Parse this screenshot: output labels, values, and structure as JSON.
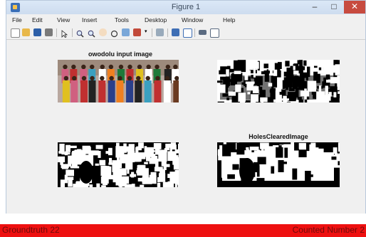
{
  "window": {
    "title": "Figure 1",
    "controls": {
      "minimize": "–",
      "maximize": "□",
      "close": "✕"
    }
  },
  "menubar": [
    "File",
    "Edit",
    "View",
    "Insert",
    "Tools",
    "Desktop",
    "Window",
    "Help"
  ],
  "toolbar": {
    "icons": [
      "new-figure-icon",
      "open-file-icon",
      "save-icon",
      "print-icon",
      "pointer-icon",
      "zoom-in-icon",
      "zoom-out-icon",
      "pan-icon",
      "rotate-3d-icon",
      "data-cursor-icon",
      "brush-icon",
      "link-plot-icon",
      "colorbar-icon",
      "legend-icon",
      "hide-plot-tools-icon",
      "show-plot-tools-icon"
    ]
  },
  "figure": {
    "panels": [
      {
        "title": "owodolu input image"
      },
      {
        "title": ""
      },
      {
        "title": ""
      },
      {
        "title": "HolesClearedImage"
      }
    ]
  },
  "statusbar": {
    "left": "Groundtruth 22",
    "right": "Counted Number 2",
    "color": "#ee1010"
  }
}
